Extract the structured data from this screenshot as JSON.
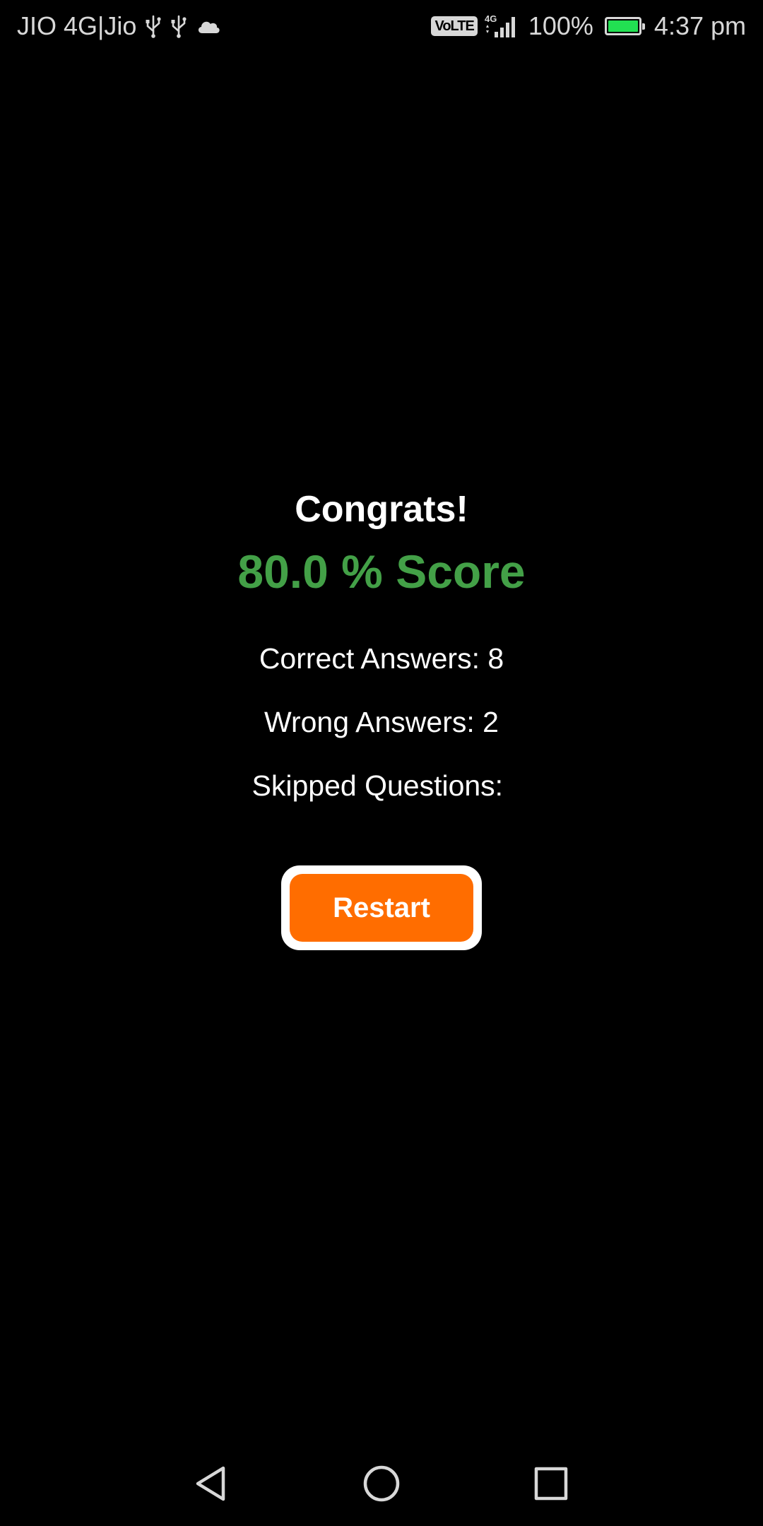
{
  "status_bar": {
    "carrier": "JIO 4G|Jio",
    "left_icons": [
      "usb-icon",
      "usb-icon",
      "cloud-icon"
    ],
    "volte": "VoLTE",
    "network": "4G",
    "battery_percent": "100%",
    "battery_level": 1.0,
    "battery_color": "#22e052",
    "time": "4:37 pm"
  },
  "result": {
    "title": "Congrats!",
    "score": "80.0 % Score",
    "score_color": "#43a047",
    "correct": "Correct Answers: 8",
    "wrong": "Wrong Answers: 2",
    "skipped": "Skipped Questions: "
  },
  "restart_button": {
    "label": "Restart",
    "color": "#ff6d00"
  },
  "nav_bar": {
    "icons": [
      "back-icon",
      "home-icon",
      "recents-icon"
    ]
  }
}
